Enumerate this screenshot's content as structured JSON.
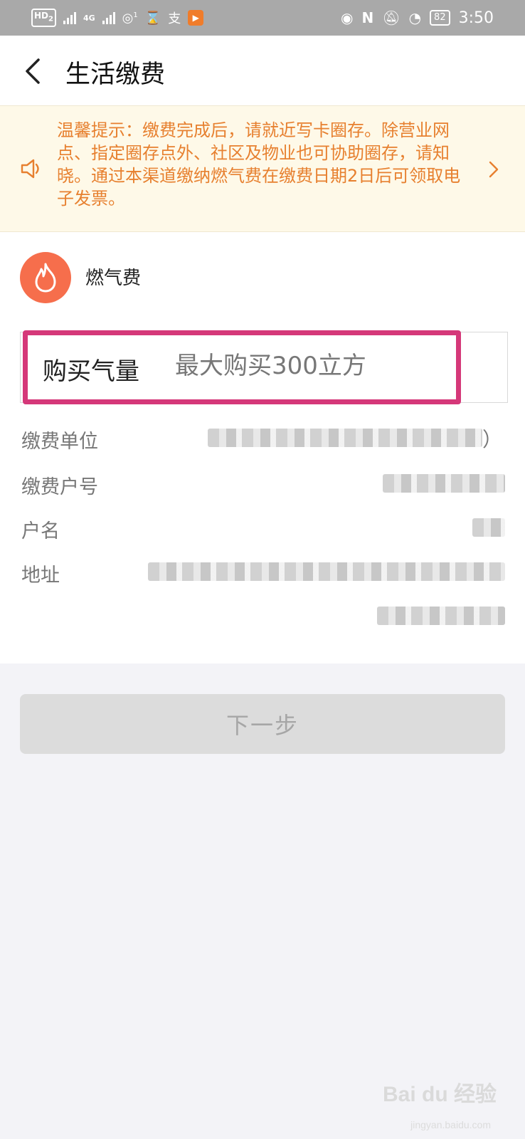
{
  "status_bar": {
    "hd_label": "HD",
    "hd_sub": "2",
    "network_label": "4G",
    "hotspot_count": "1",
    "pay_icon_glyph": "支",
    "battery": "82",
    "time": "3:50"
  },
  "header": {
    "title": "生活缴费"
  },
  "notice": {
    "text": "温馨提示：缴费完成后，请就近写卡圈存。除营业网点、指定圈存点外、社区及物业也可协助圈存，请知晓。通过本渠道缴纳燃气费在缴费日期2日后可领取电子发票。"
  },
  "service": {
    "name": "燃气费"
  },
  "purchase": {
    "label": "购买气量",
    "placeholder": "最大购买300立方"
  },
  "info": {
    "unit_label": "缴费单位",
    "unit_close": "）",
    "account_label": "缴费户号",
    "name_label": "户名",
    "address_label": "地址"
  },
  "next_button": {
    "label": "下一步"
  },
  "watermark": {
    "brand": "Bai du 经验",
    "url": "jingyan.baidu.com"
  },
  "colors": {
    "accent_orange": "#e7802f",
    "fire_badge": "#f66e4c",
    "highlight_border": "#d53879",
    "notice_bg": "#fef9e8"
  }
}
